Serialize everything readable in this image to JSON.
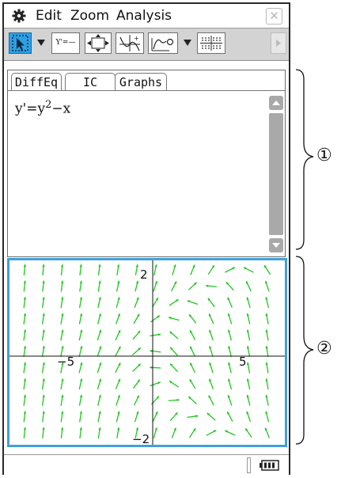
{
  "menubar": {
    "items": [
      "Edit",
      "Zoom",
      "Analysis"
    ],
    "gear_icon": "gear-icon",
    "close_icon": "close-icon"
  },
  "toolbar": {
    "buttons": [
      {
        "name": "pointer-tool",
        "icon": "cursor-select-icon",
        "selected": true
      },
      {
        "name": "dropdown-1",
        "icon": "triangle-down-icon"
      },
      {
        "name": "y-prime-list-button",
        "label": "Y'=—"
      },
      {
        "name": "zoom-fit-button",
        "icon": "expand-arrows-icon"
      },
      {
        "name": "sketch-button",
        "icon": "sketch-axes-icon"
      },
      {
        "name": "trace-button",
        "icon": "curve-trace-icon"
      },
      {
        "name": "dropdown-2",
        "icon": "triangle-down-icon"
      },
      {
        "name": "grid-button",
        "icon": "grid-dots-icon"
      },
      {
        "name": "next-toolbar-button",
        "icon": "triangle-right-icon"
      }
    ]
  },
  "editor": {
    "tabs": [
      "DiffEq",
      "IC",
      "Graphs"
    ],
    "active_tab": "DiffEq",
    "equation": {
      "lhs": "y'=y",
      "exponent": "2",
      "rhs": "−x"
    }
  },
  "graph": {
    "x_tick_labels": [
      "−5",
      "5"
    ],
    "y_tick_labels": [
      "2",
      "−2"
    ],
    "field_color": "#22c422",
    "axis_color": "#111111"
  },
  "callouts": [
    "①",
    "②"
  ],
  "colors": {
    "accent_blue": "#3fa1d6",
    "selected_tool": "#2ea0e4",
    "scroll_gray": "#a9a9a9"
  }
}
